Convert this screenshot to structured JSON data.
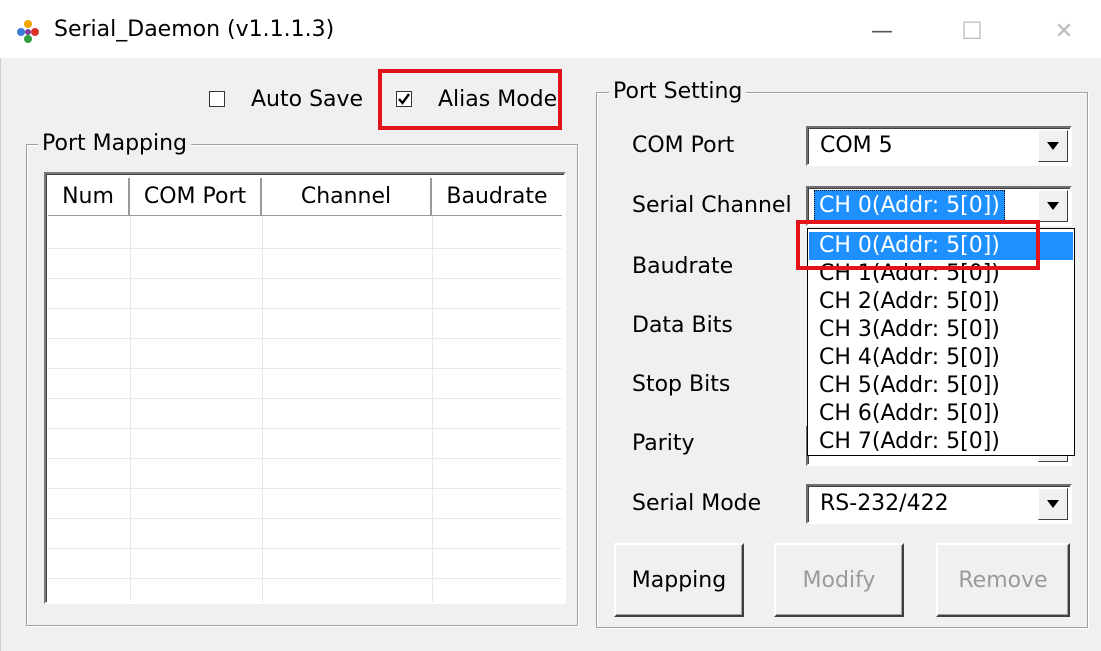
{
  "window": {
    "title": "Serial_Daemon (v1.1.1.3)",
    "minimize_glyph": "—",
    "maximize_glyph": "☐",
    "close_glyph": "✕"
  },
  "options": {
    "auto_save": {
      "label": "Auto Save",
      "checked": false
    },
    "alias_mode": {
      "label": "Alias Mode",
      "checked": true
    }
  },
  "port_mapping": {
    "legend": "Port Mapping",
    "columns": [
      "Num",
      "COM Port",
      "Channel",
      "Baudrate"
    ],
    "rows": []
  },
  "port_setting": {
    "legend": "Port Setting",
    "fields": {
      "com_port": {
        "label": "COM Port",
        "value": "COM 5"
      },
      "serial_channel": {
        "label": "Serial Channel",
        "value": "CH  0(Addr: 5[0])"
      },
      "baudrate": {
        "label": "Baudrate"
      },
      "data_bits": {
        "label": "Data Bits"
      },
      "stop_bits": {
        "label": "Stop Bits"
      },
      "parity": {
        "label": "Parity"
      },
      "serial_mode": {
        "label": "Serial Mode",
        "value": "RS-232/422"
      }
    },
    "channel_options": [
      "CH  0(Addr: 5[0])",
      "CH  1(Addr: 5[0])",
      "CH  2(Addr: 5[0])",
      "CH  3(Addr: 5[0])",
      "CH  4(Addr: 5[0])",
      "CH  5(Addr: 5[0])",
      "CH  6(Addr: 5[0])",
      "CH  7(Addr: 5[0])"
    ],
    "buttons": {
      "mapping": {
        "label": "Mapping",
        "enabled": true
      },
      "modify": {
        "label": "Modify",
        "enabled": false
      },
      "remove": {
        "label": "Remove",
        "enabled": false
      }
    }
  },
  "colors": {
    "highlight": "#e3131b",
    "selection": "#1e90ff",
    "window_bg": "#f0f0f0"
  }
}
